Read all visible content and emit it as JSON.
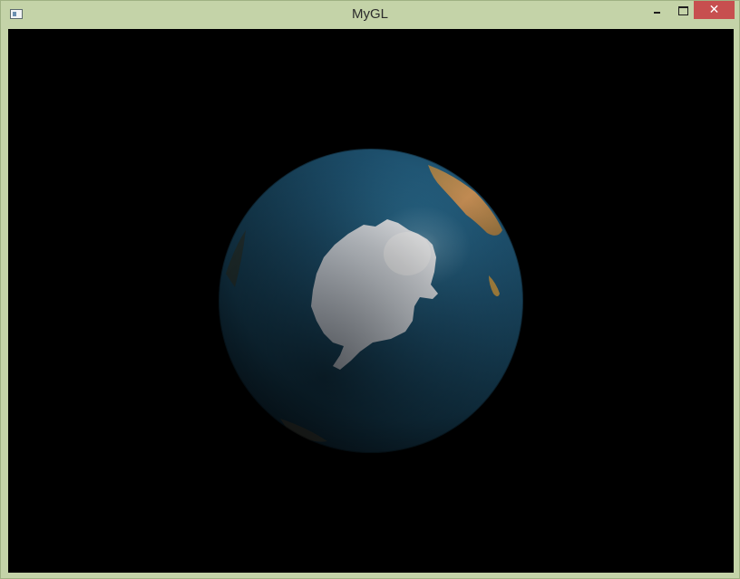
{
  "window": {
    "title": "MyGL",
    "controls": {
      "minimize_icon": "minimize-icon",
      "maximize_icon": "maximize-icon",
      "close_glyph": "✕"
    }
  },
  "scene": {
    "background_color": "#000000",
    "ocean_color": "#1d4f6c",
    "ice_color": "#eef2f6",
    "land_color": "#b8894f"
  }
}
